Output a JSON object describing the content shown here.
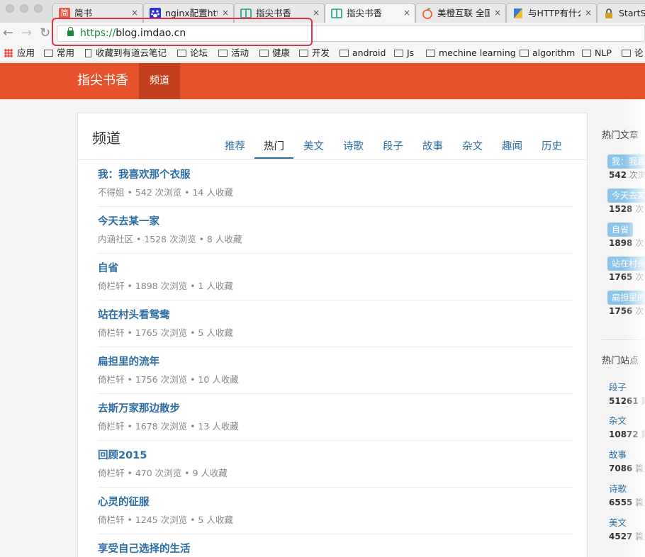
{
  "browser": {
    "tabs": [
      {
        "title": "简书",
        "favicon": "简",
        "favicon_color": "#e65a44"
      },
      {
        "title": "nginx配置https",
        "favicon": "paw",
        "favicon_color": "#2932e1"
      },
      {
        "title": "指尖书香",
        "favicon": "book",
        "favicon_color": "#1aa086"
      },
      {
        "title": "指尖书香",
        "favicon": "book",
        "favicon_color": "#1aa086"
      },
      {
        "title": "美橙互联 全国",
        "favicon": "orange",
        "favicon_color": "#f0632c"
      },
      {
        "title": "与HTTP有什么",
        "favicon": "page",
        "favicon_color": "#3a7bd5"
      },
      {
        "title": "StartS",
        "favicon": "lock",
        "favicon_color": "#444444"
      }
    ],
    "close_glyph": "×",
    "back_glyph": "←",
    "forward_glyph": "→",
    "reload_glyph": "↻",
    "url_scheme": "https://",
    "url_host": "blog.imdao.cn",
    "bookmarks": [
      "应用",
      "常用",
      "收藏到有道云笔记",
      "论坛",
      "活动",
      "健康",
      "开发",
      "android",
      "Js",
      "mechine learning",
      "algorithm",
      "NLP",
      "论"
    ]
  },
  "site": {
    "brand": "指尖书香",
    "nav_channel": "频道",
    "accent": "#e6522c"
  },
  "main": {
    "title": "频道",
    "tabs": [
      "推荐",
      "热门",
      "美文",
      "诗歌",
      "段子",
      "故事",
      "杂文",
      "趣闻",
      "历史"
    ],
    "active_tab": "热门",
    "items": [
      {
        "title": "我：我喜欢那个衣服",
        "meta": "不得姐 • 542 次浏览 • 14 人收藏"
      },
      {
        "title": "今天去某一家",
        "meta": "内涵社区 • 1528 次浏览 • 8 人收藏"
      },
      {
        "title": "自省",
        "meta": "倚栏轩 • 1898 次浏览 • 1 人收藏"
      },
      {
        "title": "站在村头看鸳鸯",
        "meta": "倚栏轩 • 1765 次浏览 • 5 人收藏"
      },
      {
        "title": "扁担里的流年",
        "meta": "倚栏轩 • 1756 次浏览 • 10 人收藏"
      },
      {
        "title": "去斯万家那边散步",
        "meta": "倚栏轩 • 1678 次浏览 • 13 人收藏"
      },
      {
        "title": "回顾2015",
        "meta": "倚栏轩 • 470 次浏览 • 9 人收藏"
      },
      {
        "title": "心灵的征服",
        "meta": "倚栏轩 • 1245 次浏览 • 5 人收藏"
      },
      {
        "title": "享受自己选择的生活",
        "meta": ""
      }
    ]
  },
  "sidebar": {
    "hot_articles_heading": "热门文章",
    "hot_articles": [
      {
        "pill": "我：我喜",
        "count": "542",
        "suffix": "次浏览"
      },
      {
        "pill": "今天去某",
        "count": "1528",
        "suffix": "次浏"
      },
      {
        "pill": "自省",
        "count": "1898",
        "suffix": "次浏"
      },
      {
        "pill": "站在村头",
        "count": "1765",
        "suffix": "次浏"
      },
      {
        "pill": "扁担里的",
        "count": "1756",
        "suffix": "次浏"
      }
    ],
    "hot_sites_heading": "热门站点",
    "hot_sites": [
      {
        "name": "段子",
        "count": "51261",
        "suffix": "篇文"
      },
      {
        "name": "杂文",
        "count": "10872",
        "suffix": "篇文"
      },
      {
        "name": "故事",
        "count": "7086",
        "suffix": "篇文"
      },
      {
        "name": "诗歌",
        "count": "6555",
        "suffix": "篇文"
      },
      {
        "name": "美文",
        "count": "4527",
        "suffix": "篇文"
      }
    ]
  }
}
